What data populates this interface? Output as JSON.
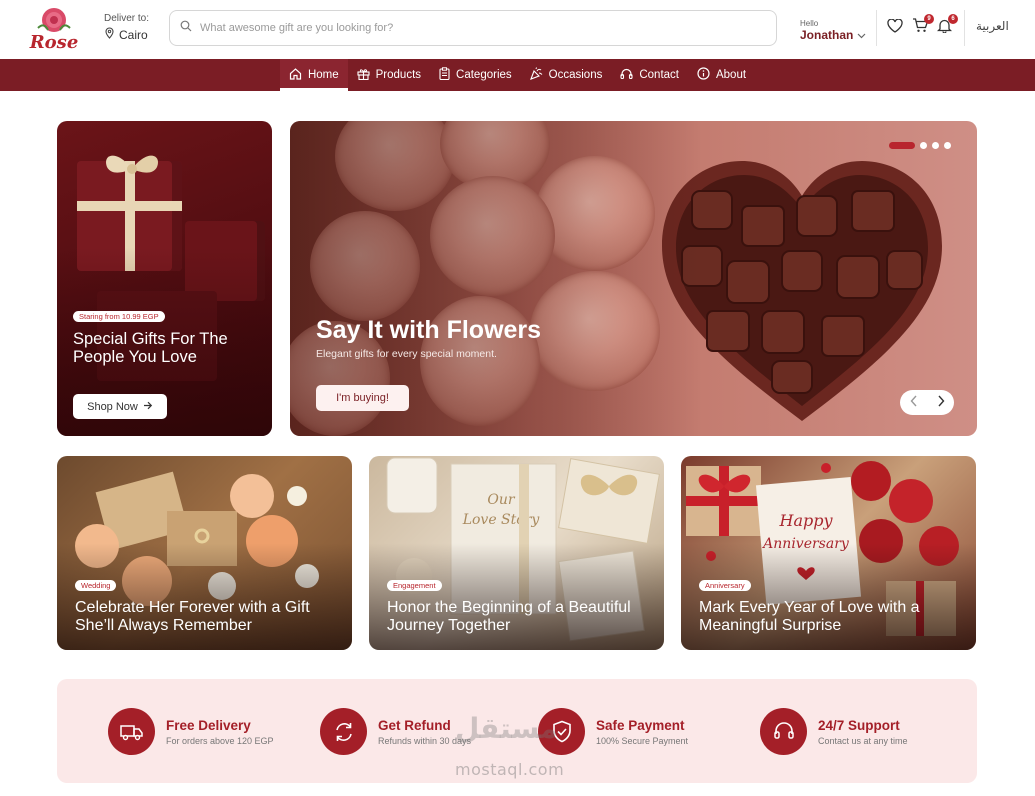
{
  "header": {
    "logo_text": "Rose",
    "deliver_label": "Deliver to:",
    "deliver_city": "Cairo",
    "search_placeholder": "What awesome gift are you looking for?",
    "user_hello": "Hello",
    "user_name": "Jonathan",
    "cart_count": "9",
    "notif_count": "6",
    "language": "العربية"
  },
  "nav": {
    "items": [
      {
        "label": "Home",
        "icon": "home-icon",
        "active": true
      },
      {
        "label": "Products",
        "icon": "gift-icon"
      },
      {
        "label": "Categories",
        "icon": "clipboard-icon"
      },
      {
        "label": "Occasions",
        "icon": "party-icon"
      },
      {
        "label": "Contact",
        "icon": "headset-icon"
      },
      {
        "label": "About",
        "icon": "info-icon"
      }
    ]
  },
  "promo": {
    "pill": "Staring from 10.99 EGP",
    "title": "Special Gifts For The People You Love",
    "button": "Shop Now"
  },
  "hero": {
    "title": "Say It with Flowers",
    "subtitle": "Elegant gifts for every special moment.",
    "button": "I'm buying!"
  },
  "occasions": [
    {
      "tag": "Wedding",
      "title": "Celebrate Her Forever with a Gift She’ll Always Remember"
    },
    {
      "tag": "Engagement",
      "title": "Honor the Beginning of a Beautiful Journey Together"
    },
    {
      "tag": "Anniversary",
      "title": "Mark Every Year of Love with a Meaningful Surprise"
    }
  ],
  "features": [
    {
      "title": "Free Delivery",
      "sub": "For orders above 120 EGP",
      "icon": "truck-icon"
    },
    {
      "title": "Get Refund",
      "sub": "Refunds within 30 days",
      "icon": "refresh-icon"
    },
    {
      "title": "Safe Payment",
      "sub": "100% Secure Payment",
      "icon": "shield-check-icon"
    },
    {
      "title": "24/7 Support",
      "sub": "Contact us at any time",
      "icon": "headset-icon"
    }
  ],
  "watermark": {
    "arabic": "مستقل",
    "latin": "mostaql.com"
  },
  "colors": {
    "brand": "#7b1d25",
    "accent": "#a41f28",
    "feature_bg": "#fbe8e8"
  }
}
